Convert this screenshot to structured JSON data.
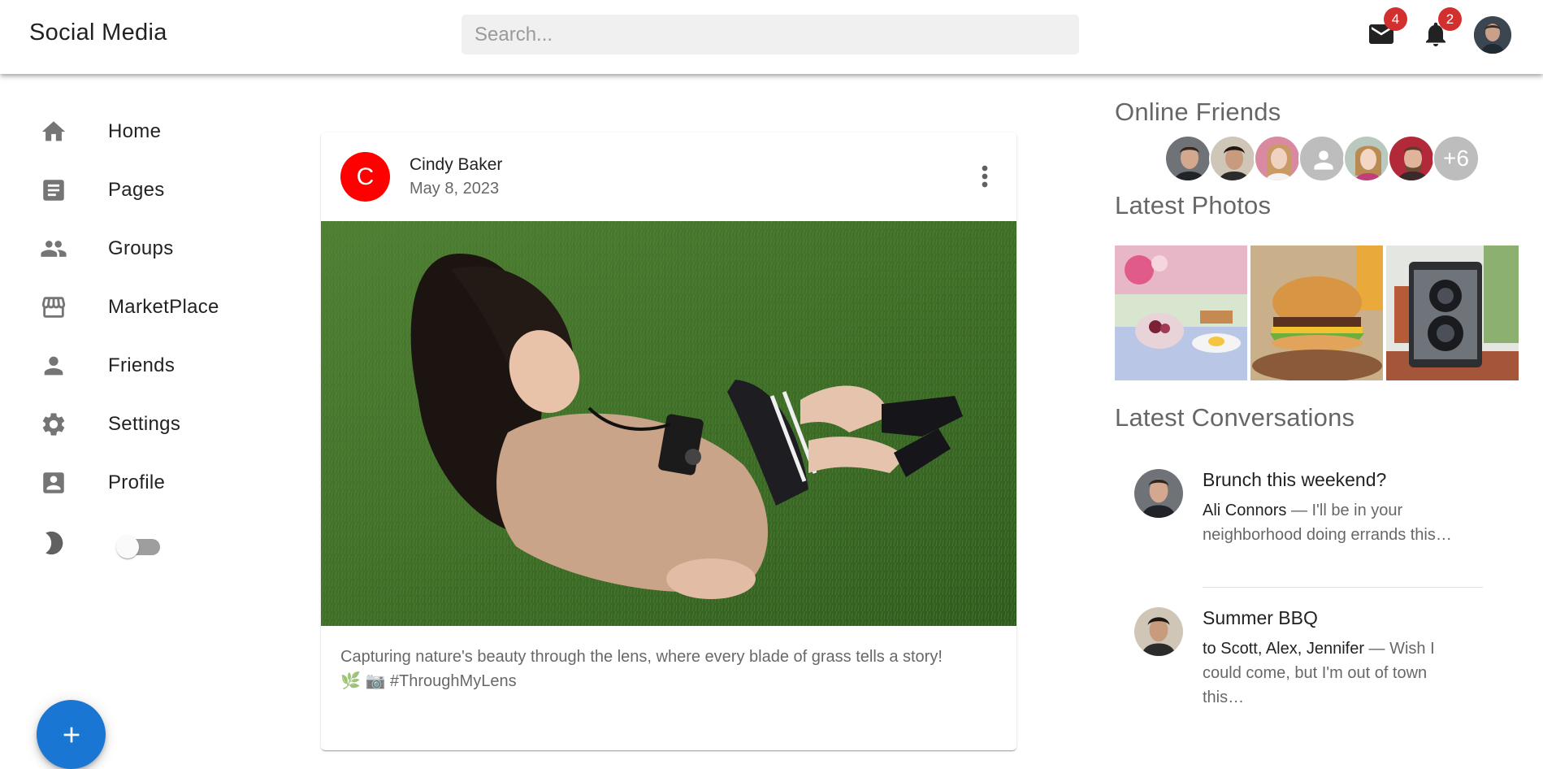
{
  "appbar": {
    "title": "Social Media",
    "search_placeholder": "Search...",
    "mail_badge": "4",
    "notifications_badge": "2"
  },
  "sidebar": {
    "items": [
      {
        "label": "Home",
        "icon": "home-icon"
      },
      {
        "label": "Pages",
        "icon": "article-icon"
      },
      {
        "label": "Groups",
        "icon": "group-icon"
      },
      {
        "label": "MarketPlace",
        "icon": "storefront-icon"
      },
      {
        "label": "Friends",
        "icon": "person-icon"
      },
      {
        "label": "Settings",
        "icon": "settings-icon"
      },
      {
        "label": "Profile",
        "icon": "account-box-icon"
      }
    ],
    "dark_mode_enabled": false
  },
  "post": {
    "avatar_letter": "C",
    "avatar_color": "#ff0000",
    "author": "Cindy Baker",
    "date": "May 8, 2023",
    "caption_line1": "Capturing nature's beauty through the lens, where every blade of grass tells a story!",
    "caption_line2": "🌿 📷 #ThroughMyLens"
  },
  "right_panel": {
    "online_friends_title": "Online Friends",
    "online_friends_more": "+6",
    "latest_photos_title": "Latest Photos",
    "latest_conversations_title": "Latest Conversations",
    "conversations": [
      {
        "title": "Brunch this weekend?",
        "from": "Ali Connors",
        "preview": " — I'll be in your neighborhood doing errands this…"
      },
      {
        "title": "Summer BBQ",
        "from": "to Scott, Alex, Jennifer",
        "preview": " — Wish I could come, but I'm out of town this…"
      }
    ]
  },
  "colors": {
    "accent": "#1976d2",
    "badge": "#d32f2f"
  }
}
